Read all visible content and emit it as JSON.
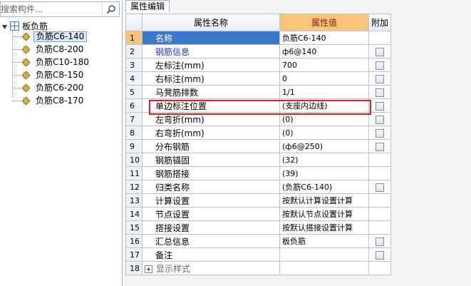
{
  "search": {
    "placeholder": "搜索构件..."
  },
  "tree": {
    "root": "板负筋",
    "items": [
      {
        "label": "负筋C6-140",
        "selected": true
      },
      {
        "label": "负筋C8-200",
        "selected": false
      },
      {
        "label": "负筋C10-180",
        "selected": false
      },
      {
        "label": "负筋C8-150",
        "selected": false
      },
      {
        "label": "负筋C6-200",
        "selected": false
      },
      {
        "label": "负筋C8-170",
        "selected": false
      }
    ]
  },
  "panel": {
    "tab": "属性编辑",
    "columns": {
      "name": "属性名称",
      "value": "属性值",
      "extra": "附加"
    },
    "rows": [
      {
        "num": "1",
        "name": "名称",
        "value": "负筋C6-140",
        "check": false,
        "style": "selected"
      },
      {
        "num": "2",
        "name": "钢筋信息",
        "value": "ф6@140",
        "check": true,
        "style": "link"
      },
      {
        "num": "3",
        "name": "左标注(mm)",
        "value": "700",
        "check": true,
        "style": ""
      },
      {
        "num": "4",
        "name": "右标注(mm)",
        "value": "0",
        "check": true,
        "style": ""
      },
      {
        "num": "5",
        "name": "马凳筋排数",
        "value": "1/1",
        "check": true,
        "style": ""
      },
      {
        "num": "6",
        "name": "单边标注位置",
        "value": "(支座内边线)",
        "check": true,
        "style": ""
      },
      {
        "num": "7",
        "name": "左弯折(mm)",
        "value": "(0)",
        "check": true,
        "style": ""
      },
      {
        "num": "8",
        "name": "右弯折(mm)",
        "value": "(0)",
        "check": true,
        "style": ""
      },
      {
        "num": "9",
        "name": "分布钢筋",
        "value": "(ф6@250)",
        "check": true,
        "style": ""
      },
      {
        "num": "10",
        "name": "钢筋锚固",
        "value": "(32)",
        "check": false,
        "style": ""
      },
      {
        "num": "11",
        "name": "钢筋搭接",
        "value": "(39)",
        "check": false,
        "style": ""
      },
      {
        "num": "12",
        "name": "归类名称",
        "value": "(负筋C6-140)",
        "check": true,
        "style": ""
      },
      {
        "num": "13",
        "name": "计算设置",
        "value": "按默认计算设置计算",
        "check": false,
        "style": ""
      },
      {
        "num": "14",
        "name": "节点设置",
        "value": "按默认节点设置计算",
        "check": false,
        "style": ""
      },
      {
        "num": "15",
        "name": "搭接设置",
        "value": "按默认搭接设置计算",
        "check": false,
        "style": ""
      },
      {
        "num": "16",
        "name": "汇总信息",
        "value": "板负筋",
        "check": true,
        "style": ""
      },
      {
        "num": "17",
        "name": "备注",
        "value": "",
        "check": true,
        "style": ""
      },
      {
        "num": "18",
        "name": "显示样式",
        "value": "",
        "check": false,
        "style": "muted"
      }
    ]
  },
  "colors": {
    "accent": "#3a78c9",
    "header_value": "#f6c57a",
    "highlight": "#e01e1e",
    "link": "#1f38c8"
  }
}
